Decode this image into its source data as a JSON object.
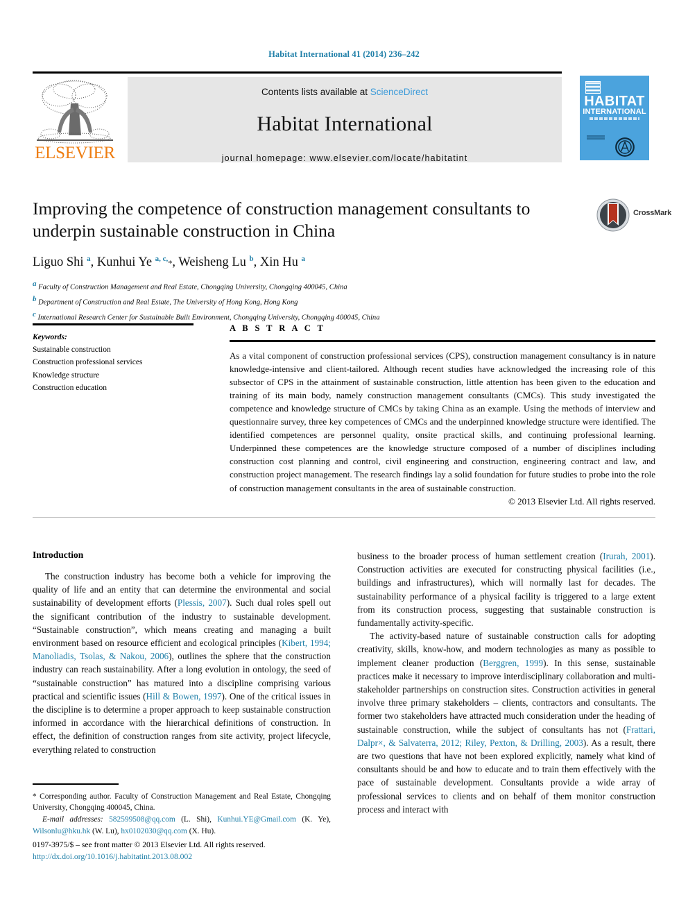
{
  "running_head": "Habitat International 41 (2014) 236–242",
  "masthead": {
    "contents_prefix": "Contents lists available at ",
    "sciencedirect": "ScienceDirect",
    "journal_name": "Habitat International",
    "homepage": "journal homepage: www.elsevier.com/locate/habitatint",
    "publisher_logo_text": "ELSEVIER",
    "cover": {
      "line1": "HABITAT",
      "line2": "INTERNATIONAL"
    }
  },
  "article": {
    "title": "Improving the competence of construction management consultants to underpin sustainable construction in China",
    "crossmark_label": "CrossMark",
    "authors_html": "Liguo Shi <sup>a</sup>, Kunhui Ye <sup>a, c,</sup><span class=\"star\">*</span>, Weisheng Lu <sup>b</sup>, Xin Hu <sup>a</sup>",
    "affiliations": [
      {
        "marker": "a",
        "text": "Faculty of Construction Management and Real Estate, Chongqing University, Chongqing 400045, China"
      },
      {
        "marker": "b",
        "text": "Department of Construction and Real Estate, The University of Hong Kong, Hong Kong"
      },
      {
        "marker": "c",
        "text": "International Research Center for Sustainable Built Environment, Chongqing University, Chongqing 400045, China"
      }
    ]
  },
  "keywords": {
    "heading": "Keywords:",
    "items": [
      "Sustainable construction",
      "Construction professional services",
      "Knowledge structure",
      "Construction education"
    ]
  },
  "abstract": {
    "heading": "A B S T R A C T",
    "text": "As a vital component of construction professional services (CPS), construction management consultancy is in nature knowledge-intensive and client-tailored. Although recent studies have acknowledged the increasing role of this subsector of CPS in the attainment of sustainable construction, little attention has been given to the education and training of its main body, namely construction management consultants (CMCs). This study investigated the competence and knowledge structure of CMCs by taking China as an example. Using the methods of interview and questionnaire survey, three key competences of CMCs and the underpinned knowledge structure were identified. The identified competences are personnel quality, onsite practical skills, and continuing professional learning. Underpinned these competences are the knowledge structure composed of a number of disciplines including construction cost planning and control, civil engineering and construction, engineering contract and law, and construction project management. The research findings lay a solid foundation for future studies to probe into the role of construction management consultants in the area of sustainable construction.",
    "copyright": "© 2013 Elsevier Ltd. All rights reserved."
  },
  "body": {
    "section_heading": "Introduction",
    "left_paragraph_1_html": "The construction industry has become both a vehicle for improving the quality of life and an entity that can determine the environmental and social sustainability of development efforts (<span class=\"ref\">Plessis, 2007</span>). Such dual roles spell out the significant contribution of the industry to sustainable development. &ldquo;Sustainable construction&rdquo;, which means creating and managing a built environment based on resource efficient and ecological principles (<span class=\"ref\">Kibert, 1994; Manoliadis, Tsolas, &amp; Nakou, 2006</span>), outlines the sphere that the construction industry can reach sustainability. After a long evolution in ontology, the seed of &ldquo;sustainable construction&rdquo; has matured into a discipline comprising various practical and scientific issues (<span class=\"ref\">Hill &amp; Bowen, 1997</span>). One of the critical issues in the discipline is to determine a proper approach to keep sustainable construction informed in accordance with the hierarchical definitions of construction. In effect, the definition of construction ranges from site activity, project lifecycle, everything related to construction",
    "right_paragraph_1_html": "business to the broader process of human settlement creation (<span class=\"ref\">Irurah, 2001</span>). Construction activities are executed for constructing physical facilities (i.e., buildings and infrastructures), which will normally last for decades. The sustainability performance of a physical facility is triggered to a large extent from its construction process, suggesting that sustainable construction is fundamentally activity-specific.",
    "right_paragraph_2_html": "The activity-based nature of sustainable construction calls for adopting creativity, skills, know-how, and modern technologies as many as possible to implement cleaner production (<span class=\"ref\">Berggren, 1999</span>). In this sense, sustainable practices make it necessary to improve interdisciplinary collaboration and multi-stakeholder partnerships on construction sites. Construction activities in general involve three primary stakeholders &ndash; clients, contractors and consultants. The former two stakeholders have attracted much consideration under the heading of sustainable construction, while the subject of consultants has not (<span class=\"ref\">Frattari, Dalpr&#215;, &amp; Salvaterra, 2012; Riley, Pexton, &amp; Drilling, 2003</span>). As a result, there are two questions that have not been explored explicitly, namely what kind of consultants should be and how to educate and to train them effectively with the pace of sustainable development. Consultants provide a wide array of professional services to clients and on behalf of them monitor construction process and interact with"
  },
  "footnote": {
    "corresponding_html": "* Corresponding author. Faculty of Construction Management and Real Estate, Chongqing University, Chongqing 400045, China.",
    "emails_html": "<span class=\"fn-email-label\">E-mail addresses:</span> <span class=\"mail\">582599508@qq.com</span> (L. Shi), <span class=\"mail\">Kunhui.YE@Gmail.com</span> (K. Ye), <span class=\"mail\">Wilsonlu@hku.hk</span> (W. Lu), <span class=\"mail\">hx0102030@qq.com</span> (X. Hu)."
  },
  "colophon": {
    "line1": "0197-3975/$ – see front matter © 2013 Elsevier Ltd. All rights reserved.",
    "doi": "http://dx.doi.org/10.1016/j.habitatint.2013.08.002"
  }
}
